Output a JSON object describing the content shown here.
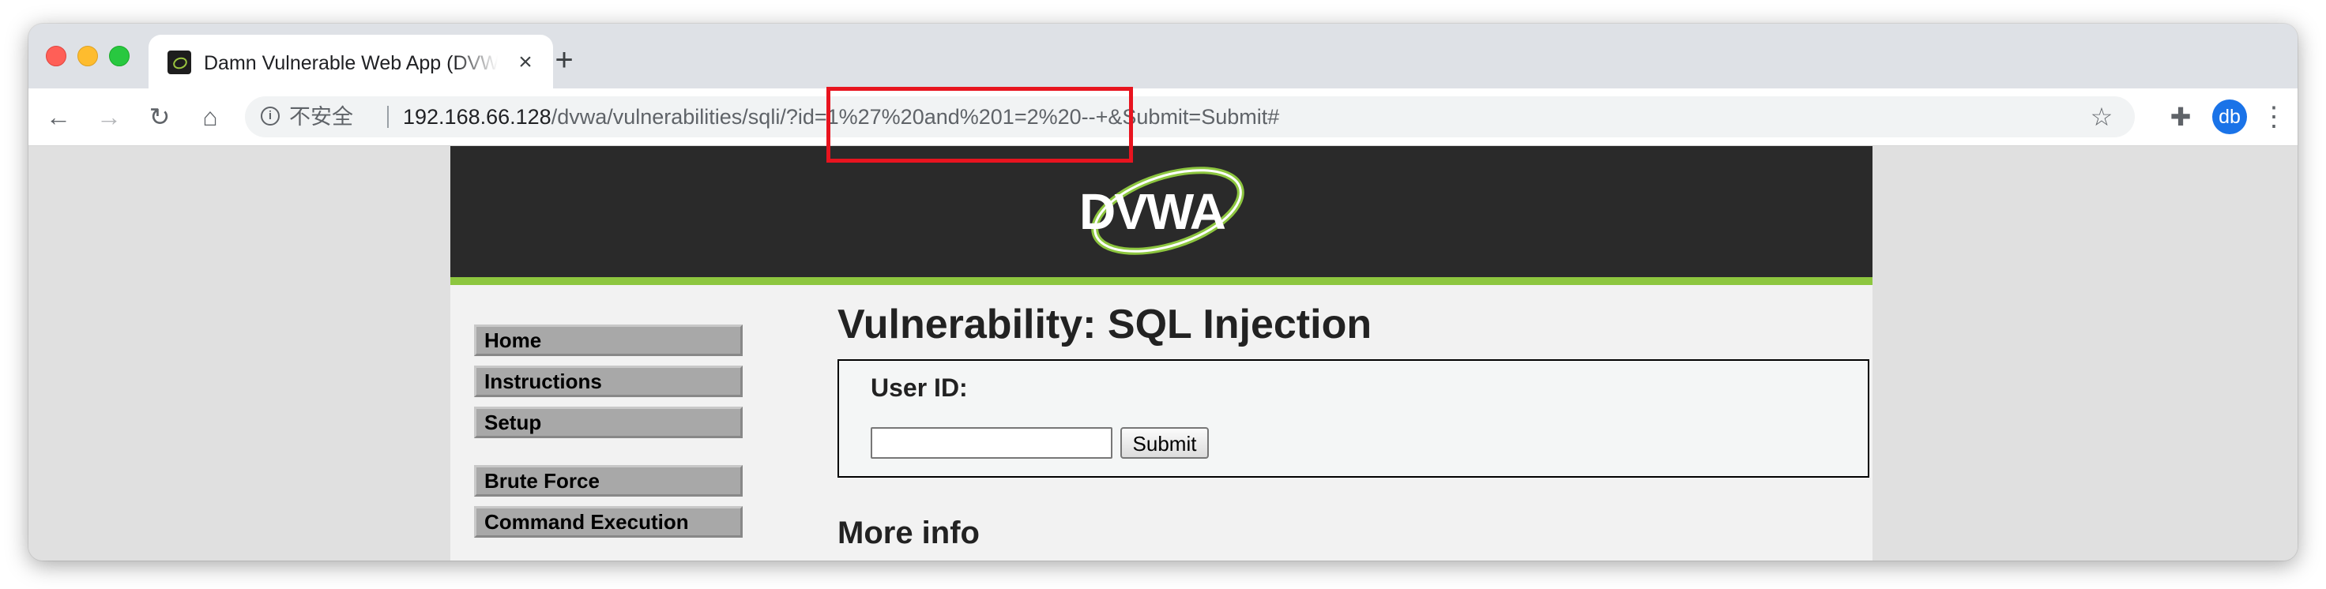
{
  "browser": {
    "tab": {
      "title": "Damn Vulnerable Web App (DVWA)",
      "close": "×"
    },
    "new_tab": "+",
    "toolbar": {
      "back": "←",
      "forward": "→",
      "reload": "↻",
      "home": "⌂"
    },
    "omnibox": {
      "insecure_label": "不安全",
      "url_host": "192.168.66.128",
      "url_path": "/dvwa/vulnerabilities/sqli/?id=1%27%20and%201=2%20--+&Submit=Submit#"
    },
    "icons": {
      "info": "i",
      "star": "☆",
      "extensions": "✚",
      "menu": "⋮"
    },
    "avatar": "db"
  },
  "page": {
    "logo_text": "DVWA",
    "title": "Vulnerability: SQL Injection",
    "menu_groups": [
      [
        "Home",
        "Instructions",
        "Setup"
      ],
      [
        "Brute Force",
        "Command Execution"
      ]
    ],
    "form": {
      "user_id_label": "User ID:",
      "user_id_value": "",
      "submit_label": "Submit"
    },
    "more_info": "More info"
  },
  "colors": {
    "header_bg": "#2a2a2a",
    "accent_green": "#8dc63f",
    "highlight_red": "#e8141f"
  }
}
